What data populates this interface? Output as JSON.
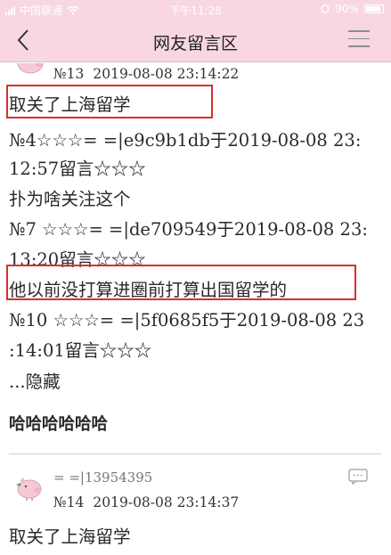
{
  "status_bar": {
    "carrier": "中国联通",
    "time": "下午11:28",
    "battery": "90%"
  },
  "nav": {
    "title": "网友留言区"
  },
  "post1": {
    "number": "№13",
    "timestamp": "2019-08-08 23:14:22",
    "lines": [
      "取关了上海留学",
      "№4☆☆☆= =|e9c9b1db于2019-08-08 23:",
      "12:57留言☆☆☆",
      "扑为啥关注这个",
      "№7 ☆☆☆= =|de709549于2019-08-08 23:",
      "13:20留言☆☆☆",
      "他以前没打算进圈前打算出国留学的",
      "№10 ☆☆☆= =|5f0685f5于2019-08-08 23",
      ":14:01留言☆☆☆",
      "...隐藏",
      "哈哈哈哈哈哈"
    ]
  },
  "post2": {
    "username": "= =|13954395",
    "number": "№14",
    "timestamp": "2019-08-08 23:14:37",
    "lines": [
      "取关了上海留学"
    ]
  },
  "colors": {
    "header_bg": "#f8d7e3",
    "highlight_box": "#d8302a"
  }
}
